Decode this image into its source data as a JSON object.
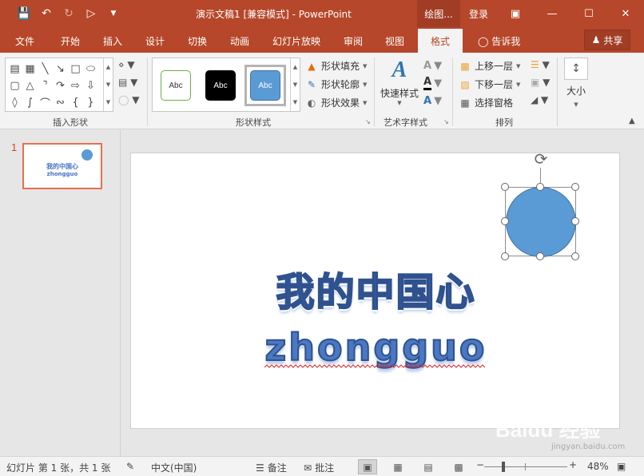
{
  "window": {
    "title": "演示文稿1 [兼容模式] - PowerPoint",
    "contextual_tab": "绘图...",
    "login": "登录",
    "icons": [
      "save-icon",
      "undo-icon",
      "redo-icon",
      "slideshow-from-start-icon",
      "customize-qat-icon"
    ],
    "controls": [
      "ribbon-display-icon",
      "minimize-icon",
      "maximize-icon",
      "close-icon"
    ]
  },
  "ribbon_tabs": {
    "file": "文件",
    "home": "开始",
    "insert": "插入",
    "design": "设计",
    "transitions": "切换",
    "animations": "动画",
    "slideshow": "幻灯片放映",
    "review": "审阅",
    "view": "视图",
    "format": "格式",
    "tell_me": "告诉我",
    "share": "共享"
  },
  "ribbon": {
    "insert_shapes": {
      "label": "插入形状"
    },
    "shape_styles": {
      "label": "形状样式",
      "swatch_text": "Abc",
      "fill": "形状填充",
      "outline": "形状轮廓",
      "effects": "形状效果"
    },
    "wordart": {
      "label": "艺术字样式",
      "quick_styles": "快速样式"
    },
    "arrange": {
      "label": "排列",
      "bring_forward": "上移一层",
      "send_backward": "下移一层",
      "selection_pane": "选择窗格"
    },
    "size": {
      "label": "大小"
    }
  },
  "thumbnails": {
    "number": "1",
    "line1": "我的中国心",
    "line2": "zhongguo"
  },
  "slide": {
    "title_line1": "我的中国心",
    "title_line2": "zhongguo"
  },
  "status": {
    "slide_count": "幻灯片 第 1 张，共 1 张",
    "language": "中文(中国)",
    "notes": "备注",
    "comments": "批注",
    "zoom": "48%"
  },
  "watermark": {
    "logo": "Baidu 经验",
    "url": "jingyan.baidu.com"
  },
  "colors": {
    "brand": "#b7472a",
    "shape_fill": "#5b9bd5",
    "wordart": "#4a78c2"
  }
}
